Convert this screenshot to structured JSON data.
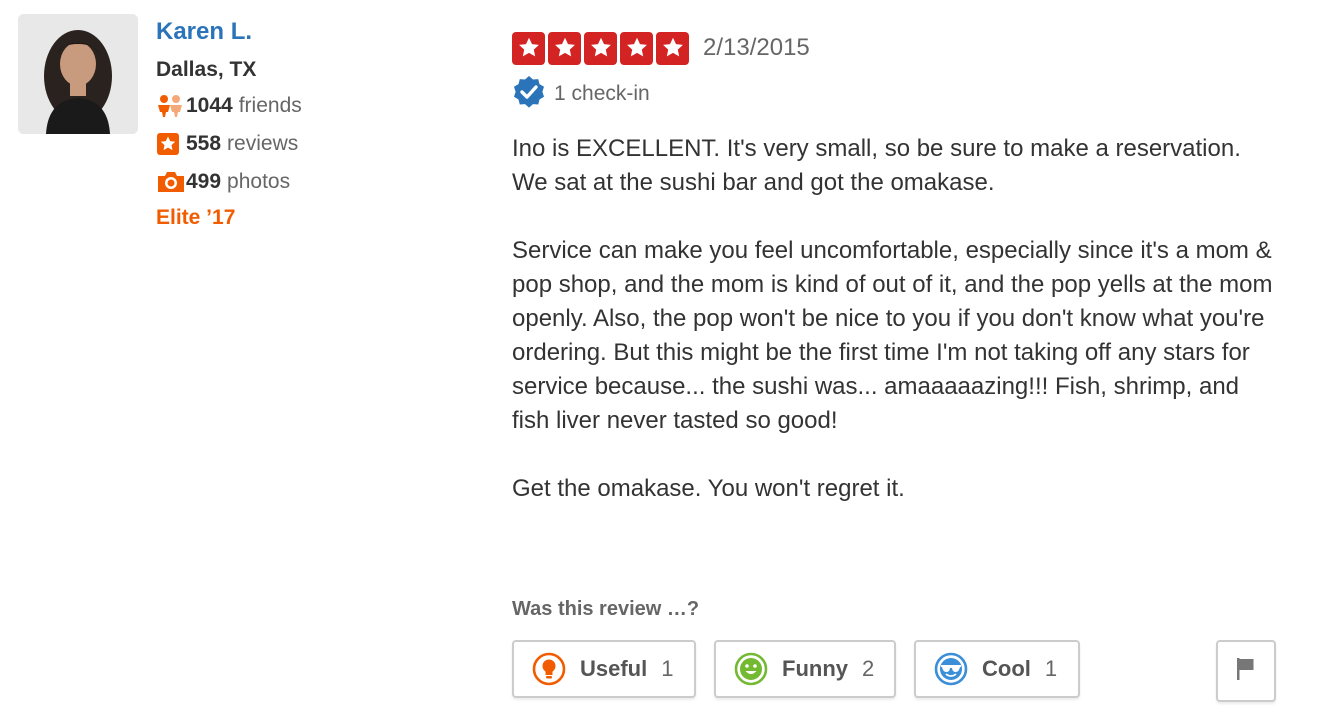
{
  "user": {
    "name": "Karen L.",
    "location": "Dallas, TX",
    "friends_count": "1044",
    "friends_label": "friends",
    "reviews_count": "558",
    "reviews_label": "reviews",
    "photos_count": "499",
    "photos_label": "photos",
    "elite": "Elite ’17"
  },
  "review": {
    "rating": 5,
    "date": "2/13/2015",
    "checkin": "1 check-in",
    "paragraphs": [
      "Ino is EXCELLENT. It's very small, so be sure to make a reservation. We sat at the sushi bar and got the omakase.",
      "Service can make you feel uncomfortable, especially since it's a mom & pop shop, and the mom is kind of out of it, and the pop yells at the mom openly. Also, the pop won't be nice to you if you don't know what you're ordering. But this might be the first time I'm not taking off any stars for service because... the sushi was... amaaaaazing!!! Fish, shrimp, and fish liver never tasted so good!",
      "Get the omakase. You won't regret it."
    ]
  },
  "votes": {
    "prompt": "Was this review …?",
    "useful": {
      "label": "Useful",
      "count": "1"
    },
    "funny": {
      "label": "Funny",
      "count": "2"
    },
    "cool": {
      "label": "Cool",
      "count": "1"
    }
  },
  "colors": {
    "star_red": "#d32323",
    "link_blue": "#2b74b9",
    "elite_orange": "#f15c00",
    "useful_orange": "#f15c00",
    "funny_green": "#73b932",
    "cool_blue": "#3b8ed8"
  },
  "icons": {
    "friends": "friends-icon",
    "reviews": "star-icon",
    "photos": "camera-icon",
    "checkin": "verified-badge-icon",
    "useful": "lightbulb-icon",
    "funny": "smiley-icon",
    "cool": "sunglasses-icon",
    "flag": "flag-icon"
  }
}
